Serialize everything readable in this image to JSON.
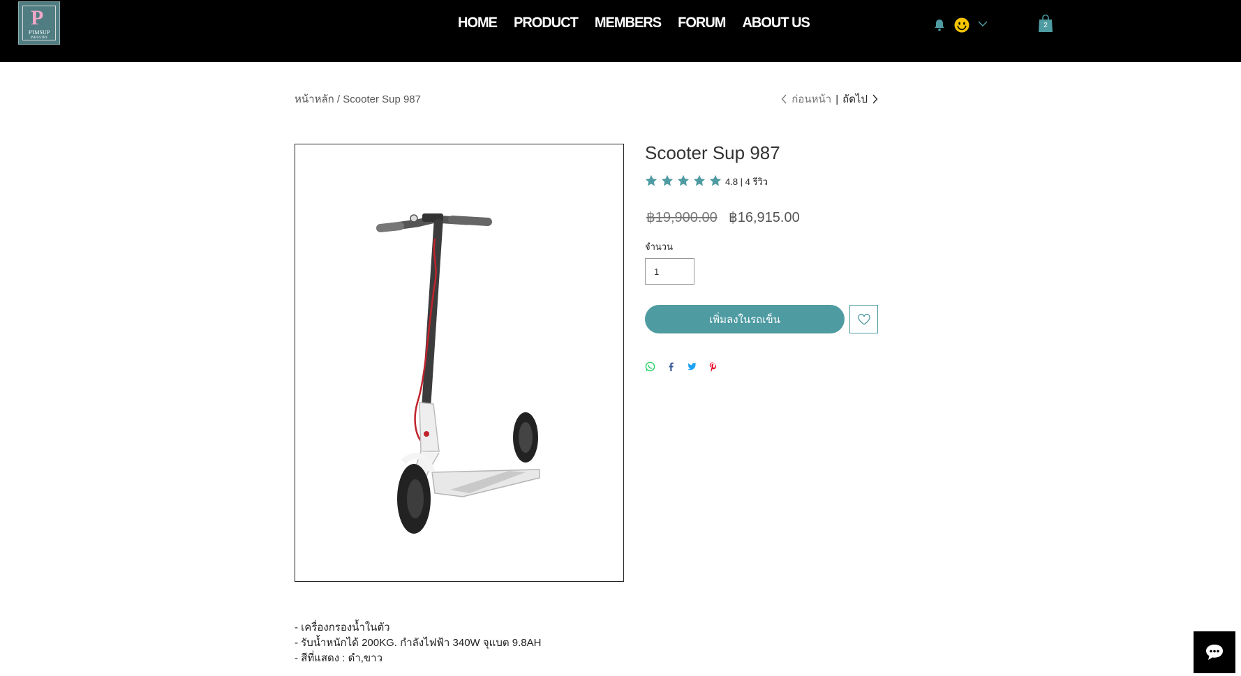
{
  "logo": {
    "letter": "P",
    "line1": "P'IMSUP",
    "line2": "INDUSTRY"
  },
  "nav": {
    "items": [
      "HOME",
      "PRODUCT",
      "MEMBERS",
      "FORUM",
      "ABOUT US"
    ]
  },
  "header": {
    "cart_count": "2",
    "icons": [
      "bell-icon",
      "smiley-avatar-icon",
      "chevron-down-icon",
      "shopping-bag-icon"
    ]
  },
  "breadcrumb": {
    "home": "หน้าหลัก",
    "separator": " / ",
    "current": "Scooter Sup 987"
  },
  "pager": {
    "prev": "ก่อนหน้า",
    "separator": "|",
    "next": "ถัดไป"
  },
  "product": {
    "title": "Scooter Sup 987",
    "rating_value": 4.8,
    "rating_text": "4.8 | 4 รีวิว",
    "price_old": "฿19,900.00",
    "price_new": "฿16,915.00",
    "quantity_label": "จำนวน",
    "quantity_value": "1",
    "add_to_cart_label": "เพิ่มลงในรถเข็น",
    "description": [
      "- เครื่องกรองน้ำในตัว",
      "- รับน้ำหนักได้ 200KG. กำลังไฟฟ้า 340W จุแบต 9.8AH",
      "- สีที่แสดง : ดำ,ขาว"
    ]
  },
  "share": [
    "whatsapp-icon",
    "facebook-icon",
    "twitter-icon",
    "pinterest-icon"
  ],
  "colors": {
    "accent": "#4e9ba2",
    "header_bg": "#000000",
    "whatsapp": "#25d366",
    "facebook": "#3b5998",
    "twitter": "#1da1f2",
    "pinterest": "#e60023"
  }
}
